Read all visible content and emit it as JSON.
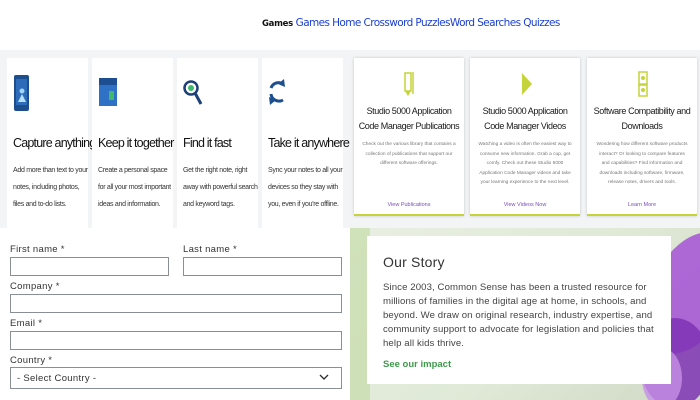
{
  "nav": {
    "brand": "Games",
    "links": [
      "Games",
      "Home",
      "Crossword Puzzles",
      "Word Searches",
      "Quizzes"
    ]
  },
  "features": [
    {
      "icon": "phone-icon",
      "title": "Capture anything",
      "desc": "Add more than text to your notes, including photos, files and to-do lists."
    },
    {
      "icon": "folder-icon",
      "title": "Keep it together",
      "desc": "Create a personal space for all your most important ideas and information."
    },
    {
      "icon": "magnifier-icon",
      "title": "Find it fast",
      "desc": "Get the right note, right away with powerful search and keyword tags."
    },
    {
      "icon": "sync-icon",
      "title": "Take it anywhere",
      "desc": "Sync your notes to all your devices so they stay with you, even if you're offline."
    }
  ],
  "downloads": [
    {
      "icon": "pencil-icon",
      "title": "Studio 5000 Application Code Manager Publications",
      "desc": "Check out the various library that contains a collection of publications that support our different software offerings.",
      "link": "View Publications"
    },
    {
      "icon": "play-icon",
      "title": "Studio 5000 Application Code Manager Videos",
      "desc": "Watching a video is often the easiest way to consume new information. Grab a cup, get comfy. Check out these Studio 5000 Application Code Manager videos and take your learning experience to the next level.",
      "link": "View Videos Now"
    },
    {
      "icon": "compatibility-icon",
      "title": "Software Compatibility and Downloads",
      "desc": "Wondering how different software products interact? Or looking to compare features and capabilities? Find information and downloads including software, firmware, release notes, drivers and tools.",
      "link": "Learn More"
    }
  ],
  "form": {
    "first_name": "First name *",
    "last_name": "Last name *",
    "company": "Company *",
    "email": "Email *",
    "country": "Country *",
    "country_value": "- Select Country -"
  },
  "story": {
    "title": "Our Story",
    "text": "Since 2003, Common Sense has been a trusted resource for millions of families in the digital age at home, in schools, and beyond. We draw on original research, industry expertise, and community support to advocate for legislation and policies that help all kids thrive.",
    "link": "See our impact"
  },
  "colors": {
    "nav_link": "#1a3fd0",
    "accent_green": "#3f9a4c",
    "lime": "#c5d43a",
    "purple": "#7b4bbe"
  }
}
